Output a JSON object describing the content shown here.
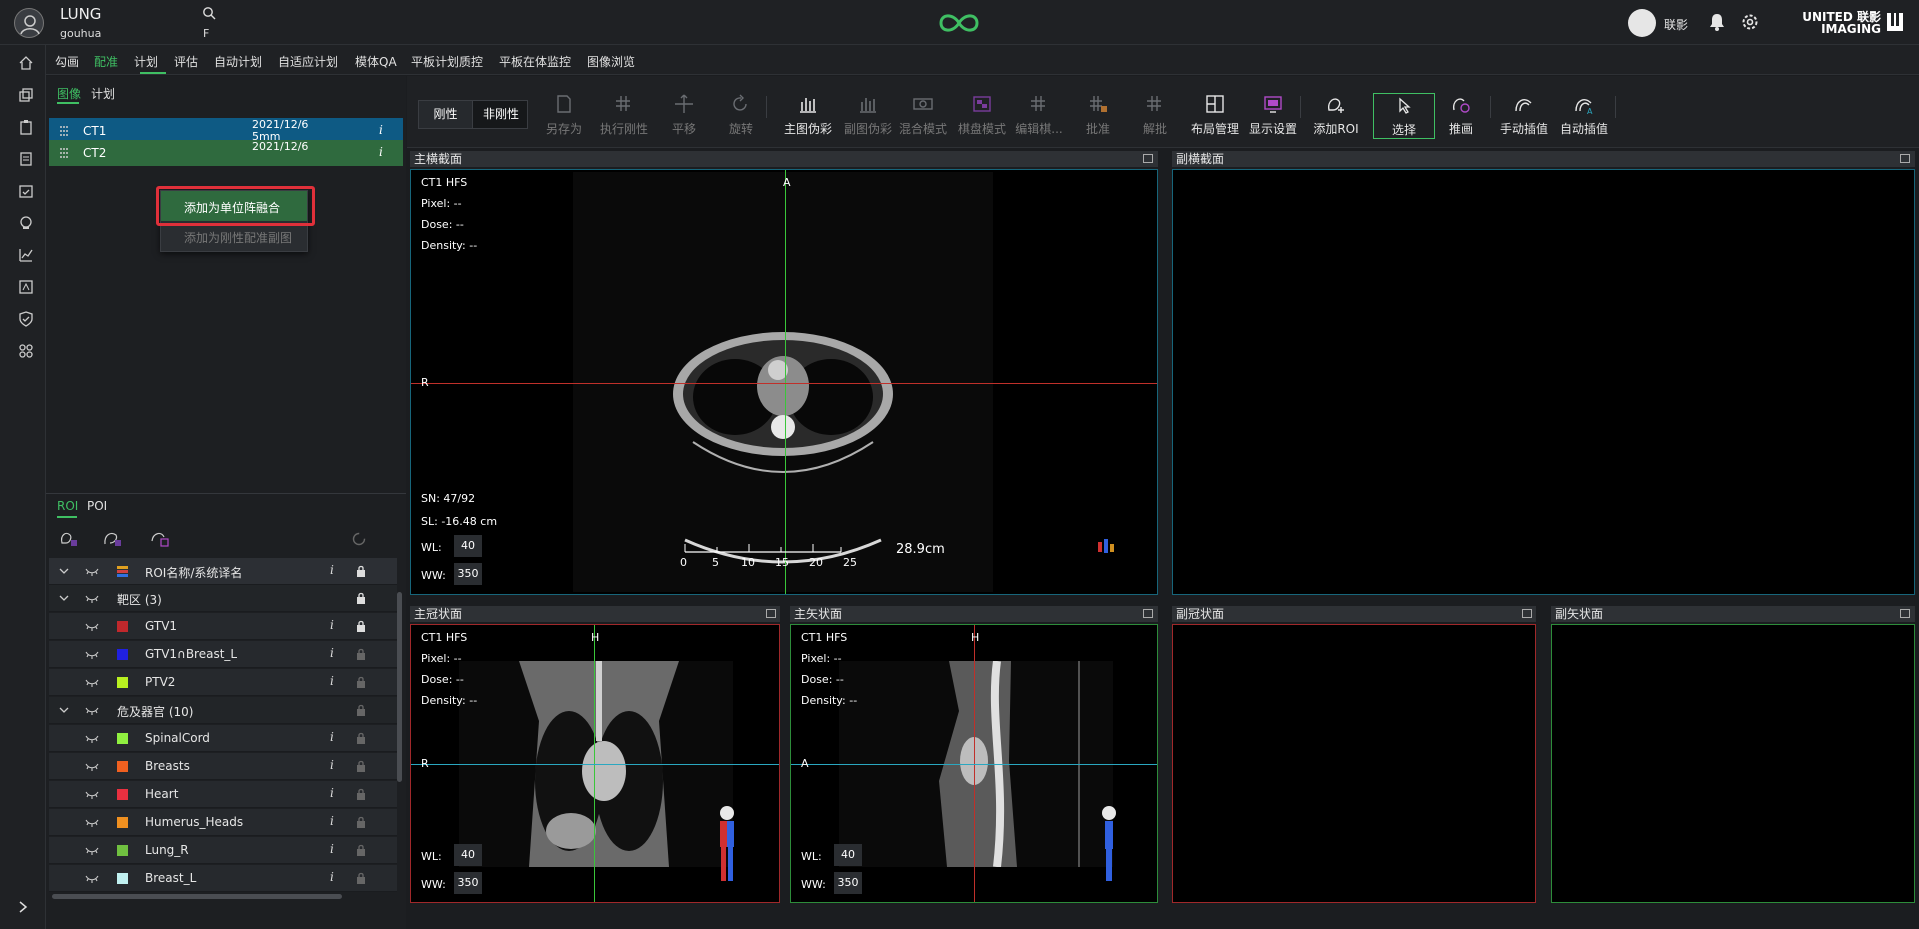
{
  "header": {
    "patient_name": "LUNG",
    "patient_sub": "gouhua",
    "patient_sex": "F",
    "user_name": "联影",
    "brand_line1": "UNITED 联影",
    "brand_line2": "IMAGING"
  },
  "menu": {
    "items": [
      "勾画",
      "配准",
      "计划",
      "评估",
      "自动计划",
      "自适应计划",
      "模体QA",
      "平板计划质控",
      "平板在体监控",
      "图像浏览"
    ],
    "active": "配准"
  },
  "left_panel": {
    "tabs": [
      "图像",
      "计划"
    ],
    "images": [
      {
        "name": "CT1",
        "date": "2021/12/6",
        "detail": "5mm",
        "info": "i"
      },
      {
        "name": "CT2",
        "date": "2021/12/6",
        "detail": "",
        "info": "i"
      }
    ],
    "context_menu": [
      "添加为单位阵融合",
      "添加为刚性配准副图"
    ]
  },
  "roi_panel": {
    "tabs": [
      "ROI",
      "POI"
    ],
    "header": {
      "name": "ROI名称/系统译名",
      "info": "i"
    },
    "rows": [
      {
        "type": "group",
        "name": "靶区 (3)"
      },
      {
        "type": "item",
        "name": "GTV1",
        "color": "#c0282c",
        "info": "i"
      },
      {
        "type": "item",
        "name": "GTV1∩Breast_L",
        "color": "#2020e0",
        "info": "i"
      },
      {
        "type": "item",
        "name": "PTV2",
        "color": "#b8f020",
        "info": "i"
      },
      {
        "type": "group",
        "name": "危及器官 (10)"
      },
      {
        "type": "item",
        "name": "SpinalCord",
        "color": "#90f040",
        "info": "i"
      },
      {
        "type": "item",
        "name": "Breasts",
        "color": "#f06020",
        "info": "i"
      },
      {
        "type": "item",
        "name": "Heart",
        "color": "#e83040",
        "info": "i"
      },
      {
        "type": "item",
        "name": "Humerus_Heads",
        "color": "#f09020",
        "info": "i"
      },
      {
        "type": "item",
        "name": "Lung_R",
        "color": "#70c040",
        "info": "i"
      },
      {
        "type": "item",
        "name": "Breast_L",
        "color": "#c0f0f0",
        "info": "i"
      }
    ]
  },
  "toolbar": {
    "mode_buttons": [
      "刚性",
      "非刚性"
    ],
    "tools": [
      {
        "label": "另存为",
        "icon": "save-icon",
        "disabled": true
      },
      {
        "label": "执行刚性",
        "icon": "grid-run-icon",
        "disabled": true
      },
      {
        "label": "平移",
        "icon": "move-icon",
        "disabled": true
      },
      {
        "label": "旋转",
        "icon": "rotate-icon",
        "disabled": true
      },
      {
        "label": "主图伪彩",
        "icon": "bars-icon",
        "disabled": false
      },
      {
        "label": "副图伪彩",
        "icon": "bars-icon",
        "disabled": true
      },
      {
        "label": "混合模式",
        "icon": "blend-icon",
        "disabled": true
      },
      {
        "label": "棋盘模式",
        "icon": "checker-icon",
        "disabled": true
      },
      {
        "label": "编辑棋...",
        "icon": "checker-edit-icon",
        "disabled": true
      },
      {
        "label": "批准",
        "icon": "approve-icon",
        "disabled": true
      },
      {
        "label": "解批",
        "icon": "unapprove-icon",
        "disabled": true
      },
      {
        "label": "布局管理",
        "icon": "layout-icon",
        "disabled": false
      },
      {
        "label": "显示设置",
        "icon": "display-icon",
        "disabled": false
      },
      {
        "label": "添加ROI",
        "icon": "add-roi-icon",
        "disabled": false
      },
      {
        "label": "选择",
        "icon": "select-icon",
        "disabled": false
      },
      {
        "label": "推画",
        "icon": "push-icon",
        "disabled": false
      },
      {
        "label": "手动插值",
        "icon": "manual-interp-icon",
        "disabled": false
      },
      {
        "label": "自动插值",
        "icon": "auto-interp-icon",
        "disabled": false
      }
    ]
  },
  "viewports": {
    "main_axial": {
      "title": "主横截面",
      "series": "CT1 HFS",
      "pixel": "Pixel:  --",
      "dose": "Dose:  --",
      "density": "Density:  --",
      "sn": "SN: 47/92",
      "sl": "SL: -16.48 cm",
      "wl_label": "WL:",
      "wl": "40",
      "ww_label": "WW:",
      "ww": "350",
      "orient_top": "A",
      "orient_left": "R",
      "scale_text": "28.9cm",
      "scale_ticks": [
        "0",
        "5",
        "10",
        "15",
        "20",
        "25"
      ]
    },
    "sub_axial": {
      "title": "副横截面"
    },
    "main_coronal": {
      "title": "主冠状面",
      "series": "CT1 HFS",
      "pixel": "Pixel:  --",
      "dose": "Dose:  --",
      "density": "Density:  --",
      "wl_label": "WL:",
      "wl": "40",
      "ww_label": "WW:",
      "ww": "350",
      "orient_top": "H",
      "orient_left": "R"
    },
    "main_sagittal": {
      "title": "主矢状面",
      "series": "CT1 HFS",
      "pixel": "Pixel:  --",
      "dose": "Dose:  --",
      "density": "Density:  --",
      "wl_label": "WL:",
      "wl": "40",
      "ww_label": "WW:",
      "ww": "350",
      "orient_top": "H",
      "orient_left": "A"
    },
    "sub_coronal": {
      "title": "副冠状面"
    },
    "sub_sagittal": {
      "title": "副矢状面"
    }
  },
  "colors": {
    "accent": "#3fbf63",
    "ct1_row": "#0e5a84",
    "ct2_row": "#2f6a3e",
    "highlight": "#e0303a"
  }
}
